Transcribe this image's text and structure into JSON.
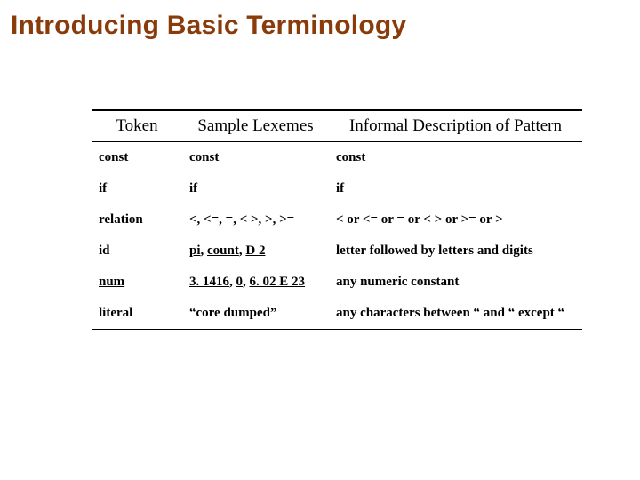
{
  "title": "Introducing Basic Terminology",
  "headers": {
    "token": "Token",
    "lexemes": "Sample Lexemes",
    "description": "Informal Description of Pattern"
  },
  "rows": [
    {
      "token": "const",
      "lexemes": "const",
      "description": "const"
    },
    {
      "token": "if",
      "lexemes": "if",
      "description": "if"
    },
    {
      "token": "relation",
      "lexemes": "<, <=, =, < >, >, >=",
      "description": "< or <= or = or < > or >= or >"
    },
    {
      "token": "id",
      "lexemes": "pi, count, D 2",
      "description": "letter followed by letters and digits"
    },
    {
      "token": "num",
      "lexemes": "3. 1416, 0, 6. 02 E 23",
      "description": "any numeric constant"
    },
    {
      "token": "literal",
      "lexemes": "“core dumped”",
      "description": "any characters between “ and “ except “"
    }
  ],
  "underline_map": {
    "id_lexemes_parts": [
      "pi",
      ", ",
      "count",
      ", ",
      "D 2"
    ],
    "num_token": true,
    "num_lexemes_parts": [
      "3. 1416",
      ", ",
      "0",
      ", ",
      "6. 02 E 23"
    ]
  }
}
